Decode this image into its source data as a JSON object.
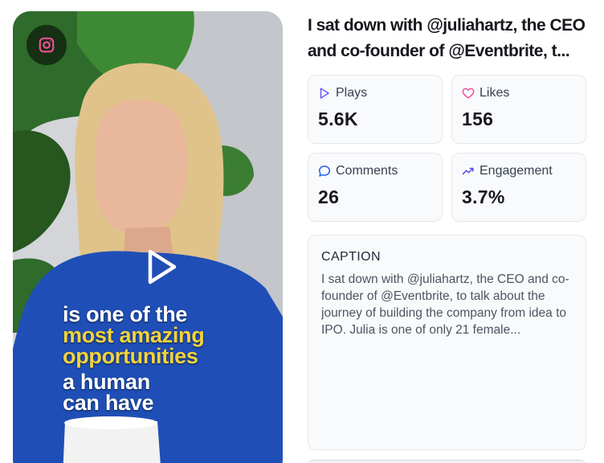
{
  "video": {
    "platform_icon": "instagram-icon",
    "play_icon": "play-icon",
    "overlay_lines": [
      {
        "text": "is one of the",
        "color": "#ffffff"
      },
      {
        "text": "most amazing",
        "color": "#f3d33b"
      },
      {
        "text": "opportunities",
        "color": "#f3d33b"
      },
      {
        "text": "a human",
        "color": "#ffffff"
      },
      {
        "text": "can have",
        "color": "#ffffff"
      }
    ]
  },
  "post": {
    "title": "I sat down with @juliahartz, the CEO and co-founder of @Eventbrite, t..."
  },
  "stats": {
    "plays": {
      "label": "Plays",
      "value": "5.6K",
      "icon": "play-outline-icon",
      "color": "#6d5dfc"
    },
    "likes": {
      "label": "Likes",
      "value": "156",
      "icon": "heart-icon",
      "color": "#ec4899"
    },
    "comments": {
      "label": "Comments",
      "value": "26",
      "icon": "comment-icon",
      "color": "#2563eb"
    },
    "engagement": {
      "label": "Engagement",
      "value": "3.7%",
      "icon": "trending-up-icon",
      "color": "#4f46e5"
    }
  },
  "caption": {
    "heading": "CAPTION",
    "text": "I sat down with @juliahartz, the CEO and co-founder of @Eventbrite, to talk about the journey of building the company from idea to IPO. Julia is one of only 21 female..."
  }
}
